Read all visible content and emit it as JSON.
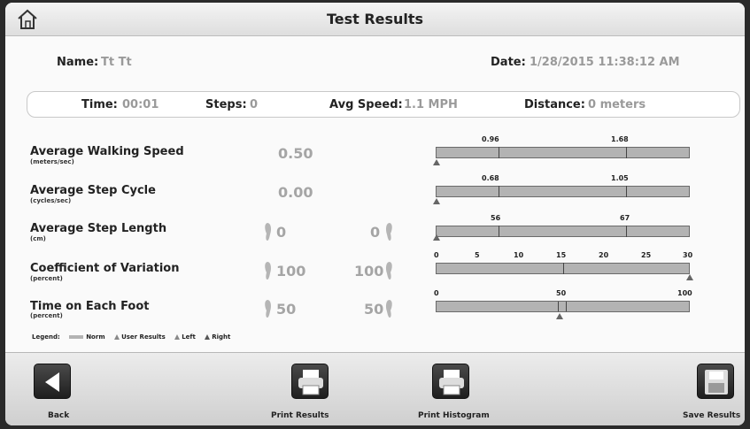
{
  "header": {
    "title": "Test Results",
    "home_icon": "home-icon"
  },
  "patient": {
    "name_label": "Name:",
    "name_value": "Tt Tt",
    "date_label": "Date:",
    "date_value": "1/28/2015 11:38:12 AM"
  },
  "summary": {
    "time_label": "Time:",
    "time_value": "00:01",
    "steps_label": "Steps:",
    "steps_value": "0",
    "speed_label": "Avg Speed:",
    "speed_value": "1.1 MPH",
    "distance_label": "Distance:",
    "distance_value": "0 meters"
  },
  "metrics": [
    {
      "name": "Average Walking Speed",
      "unit": "(meters/sec)",
      "value": "0.50",
      "norm_low": "0.96",
      "norm_high": "1.68"
    },
    {
      "name": "Average Step Cycle",
      "unit": "(cycles/sec)",
      "value": "0.00",
      "norm_low": "0.68",
      "norm_high": "1.05"
    },
    {
      "name": "Average Step Length",
      "unit": "(cm)",
      "left_value": "0",
      "right_value": "0",
      "norm_low": "56",
      "norm_high": "67"
    },
    {
      "name": "Coefficient of Variation",
      "unit": "(percent)",
      "left_value": "100",
      "right_value": "100",
      "scale": [
        "0",
        "5",
        "10",
        "15",
        "20",
        "25",
        "30"
      ],
      "norm_range": [
        0,
        15
      ]
    },
    {
      "name": "Time on Each Foot",
      "unit": "(percent)",
      "left_value": "50",
      "right_value": "50",
      "scale_low": "0",
      "scale_mid": "50",
      "scale_high": "100",
      "norm_range": [
        48,
        52
      ]
    }
  ],
  "legend": {
    "title": "Legend:",
    "norm": "Norm",
    "user": "User Results",
    "left": "Left",
    "right": "Right"
  },
  "buttons": {
    "back": "Back",
    "print_results": "Print Results",
    "print_histogram": "Print Histogram",
    "save_results": "Save Results"
  },
  "colors": {
    "norm_bar": "#b3b3b3",
    "value_text": "#9a9a9a",
    "button_dark": "#2a2a2a"
  }
}
